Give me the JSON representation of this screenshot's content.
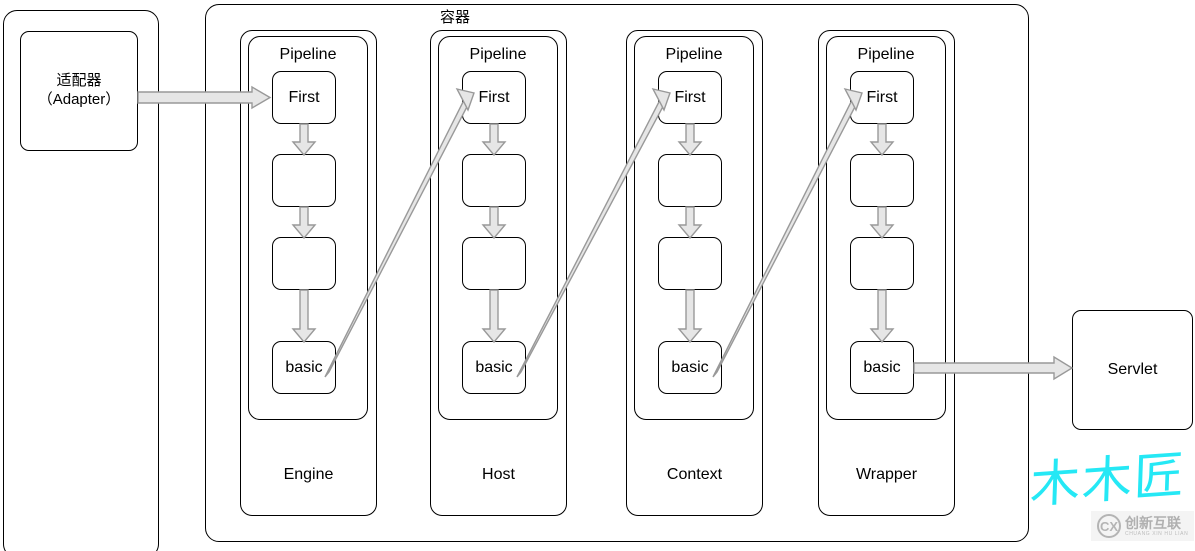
{
  "diagram": {
    "container_label": "容器",
    "adapter": {
      "line1": "适配器",
      "line2": "（Adapter）"
    },
    "servlet_label": "Servlet",
    "pipeline_title": "Pipeline",
    "first_label": "First",
    "basic_label": "basic",
    "tiers": [
      {
        "name": "Engine"
      },
      {
        "name": "Host"
      },
      {
        "name": "Context"
      },
      {
        "name": "Wrapper"
      }
    ],
    "node_labels": [
      "First",
      "",
      "",
      "basic"
    ],
    "colors": {
      "stroke": "#000000",
      "arrow_fill": "#e6e6e6",
      "arrow_stroke": "#999999",
      "background": "#ffffff",
      "watermark_cyan": "#25e8f5",
      "watermark_gray": "#b0b0b0"
    }
  },
  "watermarks": {
    "handwritten": "木木匠",
    "logo_main": "创新互联",
    "logo_sub": "CHUANG XIN HU LIAN",
    "logo_mark": "CX"
  }
}
